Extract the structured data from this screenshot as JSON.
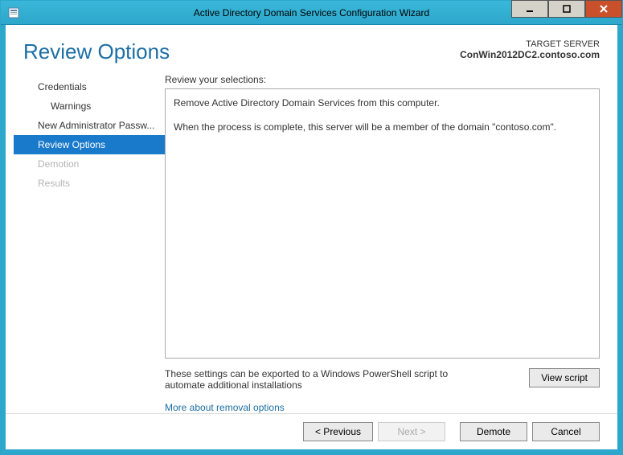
{
  "titlebar": {
    "title": "Active Directory Domain Services Configuration Wizard"
  },
  "header": {
    "page_title": "Review Options",
    "target_label": "TARGET SERVER",
    "target_value": "ConWin2012DC2.contoso.com"
  },
  "sidebar": {
    "items": [
      {
        "label": "Credentials",
        "level": 0,
        "state": "normal"
      },
      {
        "label": "Warnings",
        "level": 1,
        "state": "normal"
      },
      {
        "label": "New Administrator Passw...",
        "level": 0,
        "state": "normal"
      },
      {
        "label": "Review Options",
        "level": 0,
        "state": "active"
      },
      {
        "label": "Demotion",
        "level": 0,
        "state": "disabled"
      },
      {
        "label": "Results",
        "level": 0,
        "state": "disabled"
      }
    ]
  },
  "main": {
    "review_label": "Review your selections:",
    "review_lines": [
      "Remove Active Directory Domain Services from this computer.",
      "When the process is complete, this server will be a member of the domain \"contoso.com\"."
    ],
    "export_text": "These settings can be exported to a Windows PowerShell script to automate additional installations",
    "view_script_label": "View script",
    "more_link": "More about removal options"
  },
  "footer": {
    "previous": "< Previous",
    "next": "Next >",
    "demote": "Demote",
    "cancel": "Cancel"
  }
}
